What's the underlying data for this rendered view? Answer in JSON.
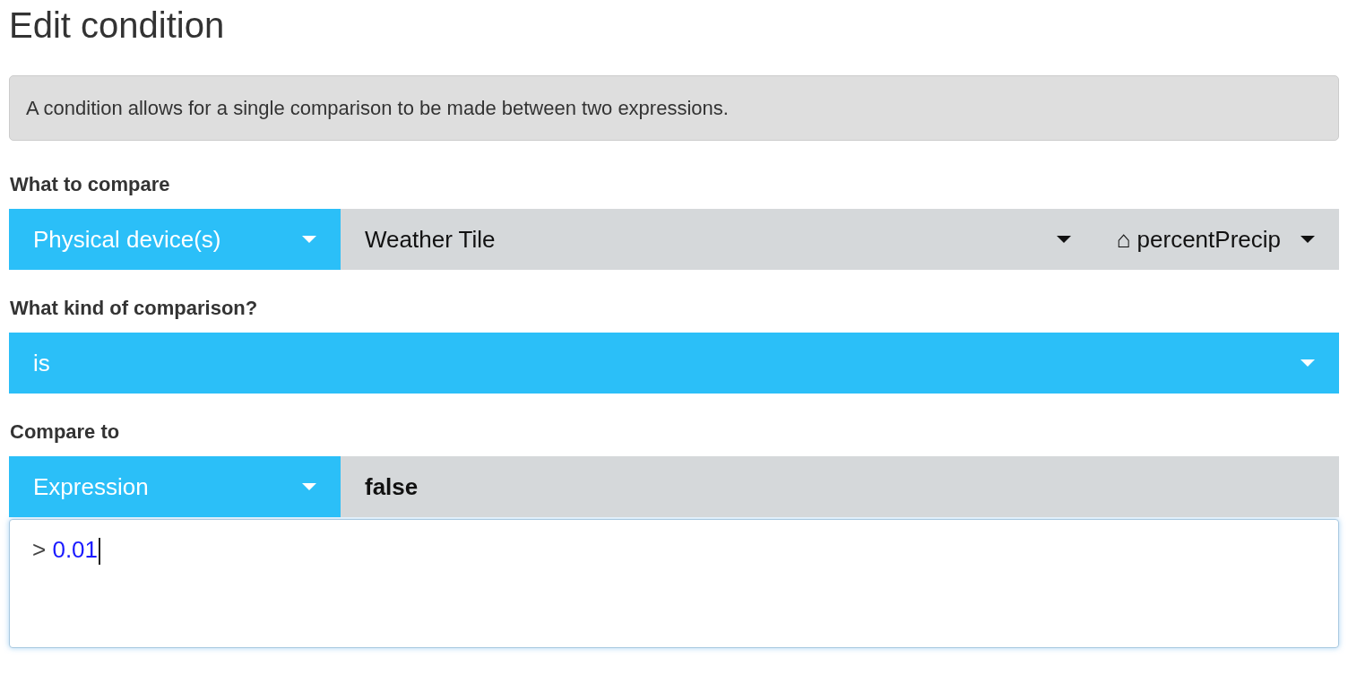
{
  "title": "Edit condition",
  "info": "A condition allows for a single comparison to be made between two expressions.",
  "sections": [
    {
      "label": "What to compare",
      "controls": [
        {
          "kind": "source",
          "text": "Physical device(s)"
        },
        {
          "kind": "device",
          "text": "Weather Tile"
        },
        {
          "kind": "attribute",
          "text": "⌂ percentPrecip"
        }
      ]
    },
    {
      "label": "What kind of comparison?",
      "controls": [
        {
          "kind": "operator",
          "text": "is"
        }
      ]
    },
    {
      "label": "Compare to",
      "controls": [
        {
          "kind": "source",
          "text": "Expression"
        },
        {
          "kind": "value",
          "text": "false"
        }
      ],
      "editor": {
        "tokens": [
          {
            "kind": "operator",
            "text": ">"
          },
          {
            "kind": "number",
            "text": "0.01"
          }
        ],
        "focused": true
      }
    }
  ]
}
